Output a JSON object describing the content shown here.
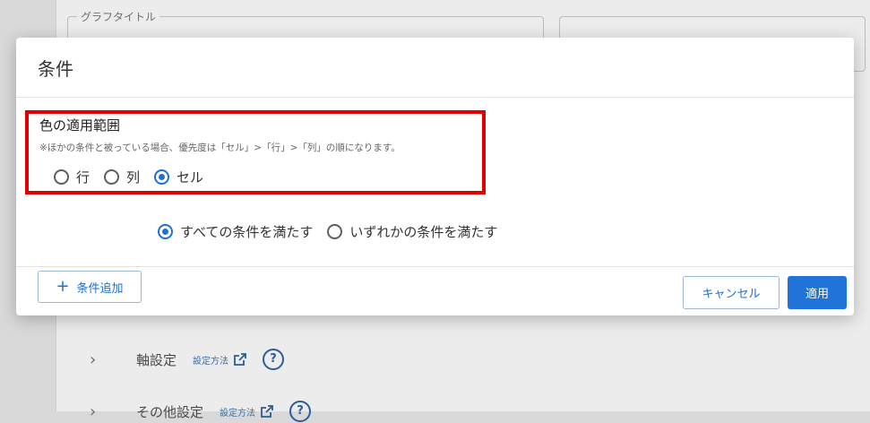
{
  "background": {
    "graph_title_legend": "グラフタイトル",
    "axis_settings_label": "軸設定",
    "axis_settings_link": "設定方法",
    "other_settings_label": "その他設定",
    "other_settings_link": "設定方法",
    "help_glyph": "?",
    "chevron_glyph": "›"
  },
  "modal": {
    "title": "条件",
    "scope": {
      "title": "色の適用範囲",
      "note": "※ほかの条件と被っている場合、優先度は「セル」>「行」>「列」の順になります。",
      "options": [
        {
          "label": "行",
          "selected": false
        },
        {
          "label": "列",
          "selected": false
        },
        {
          "label": "セル",
          "selected": true
        }
      ]
    },
    "add_condition_label": "条件追加",
    "add_icon": "+",
    "match": {
      "options": [
        {
          "label": "すべての条件を満たす",
          "selected": true
        },
        {
          "label": "いずれかの条件を満たす",
          "selected": false
        }
      ]
    },
    "cancel_label": "キャンセル",
    "apply_label": "適用"
  },
  "colors": {
    "accent": "#1f73d9",
    "highlight": "#e00000"
  },
  "icons": {
    "external_link": "external-link-icon",
    "help": "help-icon",
    "plus": "plus-icon",
    "chevron": "chevron-right-icon"
  }
}
